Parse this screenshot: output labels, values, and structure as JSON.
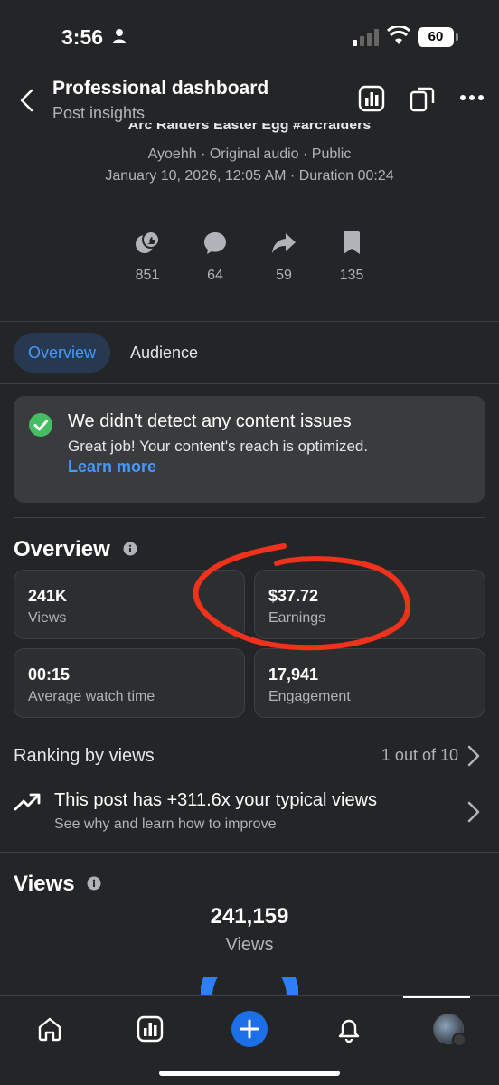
{
  "status_bar": {
    "time": "3:56",
    "battery": "60"
  },
  "header": {
    "title": "Professional dashboard",
    "subtitle": "Post insights"
  },
  "post": {
    "title": "Arc Raiders Easter Egg #arcraiders",
    "meta": "Ayoehh · Original audio · Public",
    "date": "January 10, 2026, 12:05 AM · Duration 00:24"
  },
  "stats": [
    {
      "icon": "reactions-icon",
      "value": "851"
    },
    {
      "icon": "comment-icon",
      "value": "64"
    },
    {
      "icon": "share-icon",
      "value": "59"
    },
    {
      "icon": "bookmark-icon",
      "value": "135"
    }
  ],
  "tabs": {
    "overview": "Overview",
    "audience": "Audience"
  },
  "notice": {
    "title": "We didn't detect any content issues",
    "text": "Great job! Your content's reach is optimized.",
    "link": "Learn more"
  },
  "overview": {
    "title": "Overview",
    "cards": [
      {
        "value": "241K",
        "label": "Views"
      },
      {
        "value": "$37.72",
        "label": "Earnings"
      },
      {
        "value": "00:15",
        "label": "Average watch time"
      },
      {
        "value": "17,941",
        "label": "Engagement"
      }
    ]
  },
  "ranking": {
    "title": "Ranking by views",
    "value": "1 out of 10"
  },
  "typical": {
    "title": "This post has +311.6x your typical views",
    "subtitle": "See why and learn how to improve"
  },
  "views": {
    "title": "Views",
    "number": "241,159",
    "label": "Views"
  },
  "colors": {
    "accent": "#4599ff",
    "annotation": "#f0321c",
    "success": "#45bd62"
  }
}
